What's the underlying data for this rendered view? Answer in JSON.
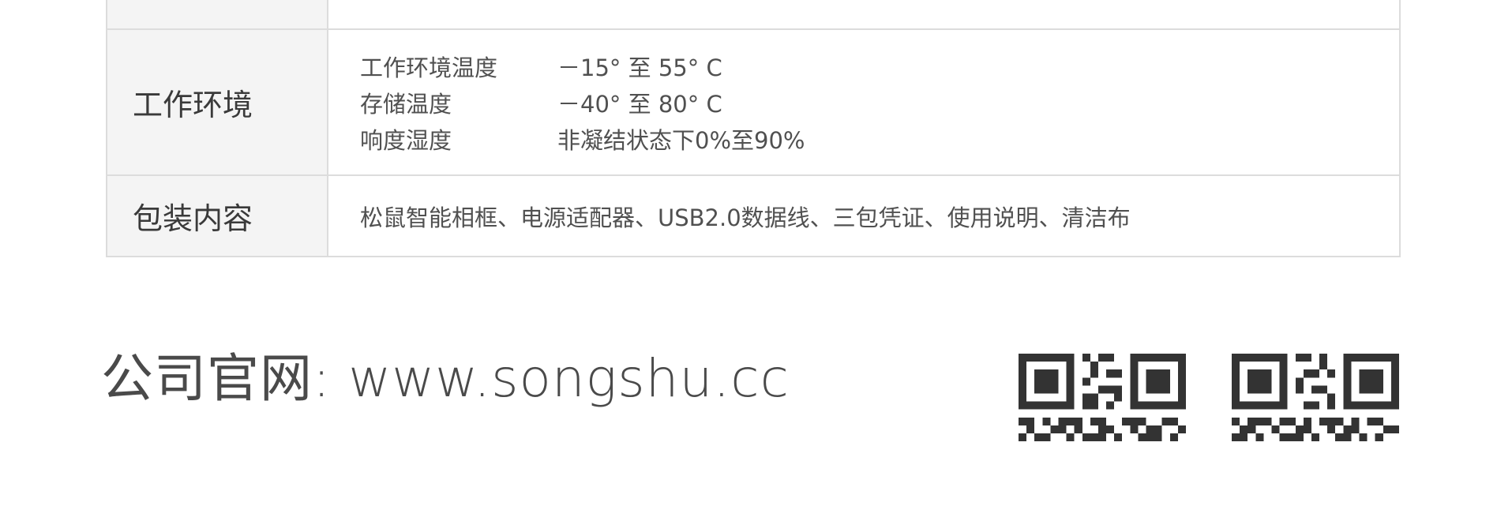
{
  "spec_table": {
    "rows": [
      {
        "label": "工作环境",
        "lines": [
          {
            "key": "工作环境温度",
            "value": "－15°  至 55°  C"
          },
          {
            "key": "存储温度",
            "value": "－40°  至 80°   C"
          },
          {
            "key": "响度湿度",
            "value": " 非凝结状态下0%至90%"
          }
        ]
      },
      {
        "label": "包装内容",
        "text": "松鼠智能相框、电源适配器、USB2.0数据线、三包凭证、使用说明、清洁布"
      }
    ]
  },
  "footer": {
    "website": "公司官网: www.songshu.cc",
    "qr_codes": [
      "qr-code-icon",
      "qr-code-icon"
    ]
  },
  "colors": {
    "label_bg": "#f4f4f4",
    "border": "#dcdcdc",
    "text": "#4a4a4a"
  }
}
